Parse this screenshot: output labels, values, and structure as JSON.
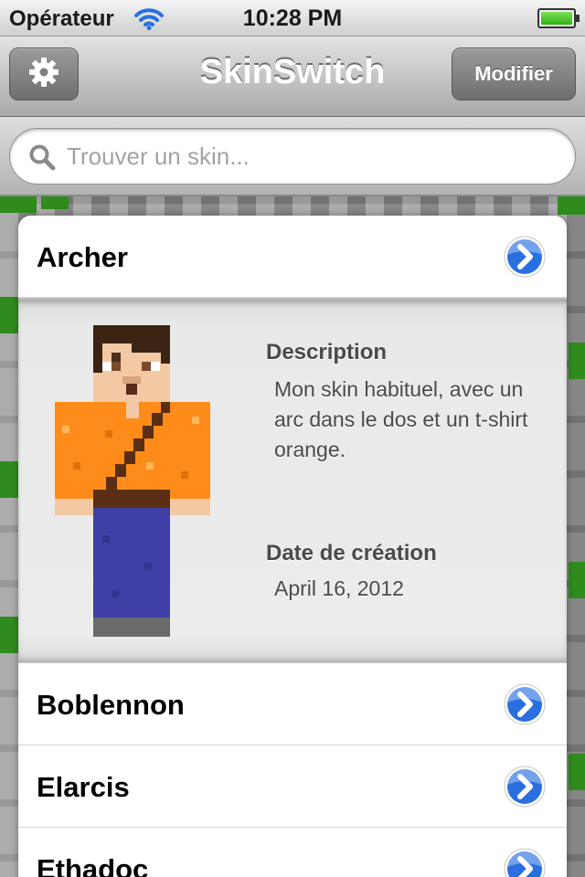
{
  "status_bar": {
    "carrier": "Opérateur",
    "time": "10:28 PM",
    "battery_level_percent": 100,
    "icons": [
      "wifi-icon",
      "battery-icon"
    ]
  },
  "nav_bar": {
    "title": "SkinSwitch",
    "settings_icon": "gear-icon",
    "right_button_label": "Modifier"
  },
  "search": {
    "placeholder": "Trouver un skin...",
    "value": "",
    "icon": "search-icon"
  },
  "skins": [
    {
      "name": "Archer",
      "expanded": true,
      "description_heading": "Description",
      "description": "Mon skin habituel, avec un arc dans le dos et un t-shirt orange.",
      "date_heading": "Date de création",
      "date": "April 16, 2012"
    },
    {
      "name": "Boblennon"
    },
    {
      "name": "Elarcis"
    },
    {
      "name": "Ethadoc"
    }
  ],
  "colors": {
    "accent_disclosure": "#2a6fe0",
    "shirt_orange": "#ff8c1a",
    "pants_blue": "#3f3fa6",
    "hair_brown": "#3b2414"
  }
}
